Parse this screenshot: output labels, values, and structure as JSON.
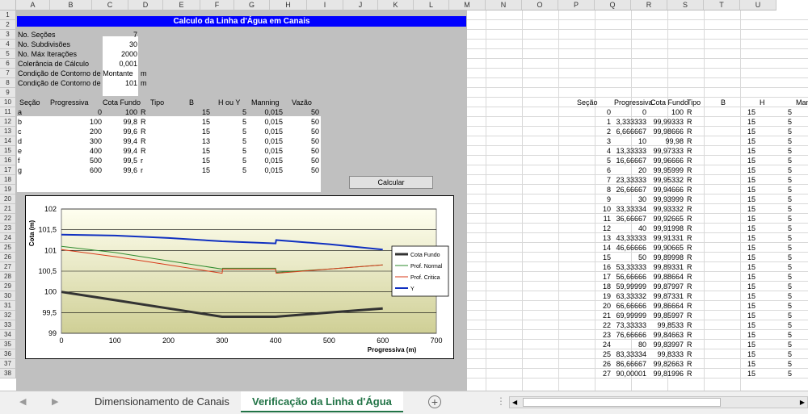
{
  "columns": [
    "A",
    "B",
    "C",
    "D",
    "E",
    "F",
    "G",
    "H",
    "I",
    "J",
    "K",
    "L",
    "M",
    "N",
    "O",
    "P",
    "Q",
    "R",
    "S",
    "T",
    "U"
  ],
  "rows": [
    "1",
    "2",
    "3",
    "4",
    "5",
    "6",
    "7",
    "8",
    "9",
    "10",
    "11",
    "12",
    "13",
    "14",
    "15",
    "16",
    "17",
    "18",
    "19",
    "20",
    "21",
    "22",
    "23",
    "24",
    "25",
    "26",
    "27",
    "28",
    "29",
    "30",
    "31",
    "32",
    "33",
    "34",
    "35",
    "36",
    "37",
    "38"
  ],
  "title": "Calculo da Linha d'Água em Canais",
  "params": [
    {
      "label": "No. Seções",
      "value": "7"
    },
    {
      "label": "No. Subdivisões",
      "value": "30"
    },
    {
      "label": "No. Máx Iterações",
      "value": "2000"
    },
    {
      "label": "Colerância de Cálculo",
      "value": "0,001"
    },
    {
      "label": "Condição de Contorno de Montante",
      "value": "",
      "unit": "m"
    },
    {
      "label": "Condição de Contorno de",
      "value": "101",
      "unit": "m"
    }
  ],
  "sections_header": [
    "Seção",
    "Progressiva",
    "Cota Fundo",
    "Tipo",
    "B",
    "H ou Y",
    "Manning",
    "Vazão"
  ],
  "sections": [
    [
      "a",
      "0",
      "100",
      "R",
      "15",
      "5",
      "0,015",
      "50"
    ],
    [
      "b",
      "100",
      "99,8",
      "R",
      "15",
      "5",
      "0,015",
      "50"
    ],
    [
      "c",
      "200",
      "99,6",
      "R",
      "15",
      "5",
      "0,015",
      "50"
    ],
    [
      "d",
      "300",
      "99,4",
      "R",
      "13",
      "5",
      "0,015",
      "50"
    ],
    [
      "e",
      "400",
      "99,4",
      "R",
      "15",
      "5",
      "0,015",
      "50"
    ],
    [
      "f",
      "500",
      "99,5",
      "r",
      "15",
      "5",
      "0,015",
      "50"
    ],
    [
      "g",
      "600",
      "99,6",
      "r",
      "15",
      "5",
      "0,015",
      "50"
    ]
  ],
  "calc_button": "Calcular",
  "results_header": [
    "Seção",
    "Progressiva",
    "Cota Fundo",
    "Tipo",
    "B",
    "H",
    "Man"
  ],
  "results": [
    [
      "0",
      "0",
      "100",
      "R",
      "15",
      "5"
    ],
    [
      "1",
      "3,333333",
      "99,99333",
      "R",
      "15",
      "5"
    ],
    [
      "2",
      "6,666667",
      "99,98666",
      "R",
      "15",
      "5"
    ],
    [
      "3",
      "10",
      "99,98",
      "R",
      "15",
      "5"
    ],
    [
      "4",
      "13,33333",
      "99,97333",
      "R",
      "15",
      "5"
    ],
    [
      "5",
      "16,66667",
      "99,96666",
      "R",
      "15",
      "5"
    ],
    [
      "6",
      "20",
      "99,95999",
      "R",
      "15",
      "5"
    ],
    [
      "7",
      "23,33333",
      "99,95332",
      "R",
      "15",
      "5"
    ],
    [
      "8",
      "26,66667",
      "99,94666",
      "R",
      "15",
      "5"
    ],
    [
      "9",
      "30",
      "99,93999",
      "R",
      "15",
      "5"
    ],
    [
      "10",
      "33,33334",
      "99,93332",
      "R",
      "15",
      "5"
    ],
    [
      "11",
      "36,66667",
      "99,92665",
      "R",
      "15",
      "5"
    ],
    [
      "12",
      "40",
      "99,91998",
      "R",
      "15",
      "5"
    ],
    [
      "13",
      "43,33333",
      "99,91331",
      "R",
      "15",
      "5"
    ],
    [
      "14",
      "46,66666",
      "99,90665",
      "R",
      "15",
      "5"
    ],
    [
      "15",
      "50",
      "99,89998",
      "R",
      "15",
      "5"
    ],
    [
      "16",
      "53,33333",
      "99,89331",
      "R",
      "15",
      "5"
    ],
    [
      "17",
      "56,66666",
      "99,88664",
      "R",
      "15",
      "5"
    ],
    [
      "18",
      "59,99999",
      "99,87997",
      "R",
      "15",
      "5"
    ],
    [
      "19",
      "63,33332",
      "99,87331",
      "R",
      "15",
      "5"
    ],
    [
      "20",
      "66,66666",
      "99,86664",
      "R",
      "15",
      "5"
    ],
    [
      "21",
      "69,99999",
      "99,85997",
      "R",
      "15",
      "5"
    ],
    [
      "22",
      "73,33333",
      "99,8533",
      "R",
      "15",
      "5"
    ],
    [
      "23",
      "76,66666",
      "99,84663",
      "R",
      "15",
      "5"
    ],
    [
      "24",
      "80",
      "99,83997",
      "R",
      "15",
      "5"
    ],
    [
      "25",
      "83,33334",
      "99,8333",
      "R",
      "15",
      "5"
    ],
    [
      "26",
      "86,66667",
      "99,82663",
      "R",
      "15",
      "5"
    ],
    [
      "27",
      "90,00001",
      "99,81996",
      "R",
      "15",
      "5"
    ]
  ],
  "tabs": [
    "Dimensionamento de Canais",
    "Verificação da Linha d'Água"
  ],
  "active_tab": 1,
  "chart_data": {
    "type": "line",
    "ylabel": "Cota (m)",
    "xlabel": "Progressiva (m)",
    "xlim": [
      0,
      700
    ],
    "ylim": [
      99,
      102
    ],
    "xticks": [
      "0",
      "100",
      "200",
      "300",
      "400",
      "500",
      "600",
      "700"
    ],
    "yticks": [
      "99",
      "99,5",
      "100",
      "100,5",
      "101",
      "101,5",
      "102"
    ],
    "legend": "right",
    "series": [
      {
        "name": "Cota Fundo",
        "color": "#333333",
        "x": [
          0,
          100,
          200,
          300,
          400,
          500,
          600
        ],
        "y": [
          100,
          99.8,
          99.6,
          99.4,
          99.4,
          99.5,
          99.6
        ]
      },
      {
        "name": "Prof. Normal",
        "color": "#2e8b2e",
        "x": [
          0,
          100,
          200,
          300,
          301,
          400,
          401,
          500,
          600
        ],
        "y": [
          101.1,
          100.95,
          100.75,
          100.55,
          100.57,
          100.57,
          100.47,
          100.55,
          100.65
        ]
      },
      {
        "name": "Prof. Critica",
        "color": "#d83a1a",
        "x": [
          0,
          100,
          200,
          300,
          301,
          400,
          401,
          500,
          600
        ],
        "y": [
          101.02,
          100.85,
          100.65,
          100.45,
          100.55,
          100.55,
          100.45,
          100.55,
          100.65
        ]
      },
      {
        "name": "Y",
        "color": "#1030c0",
        "x": [
          0,
          100,
          200,
          300,
          400,
          401,
          500,
          600
        ],
        "y": [
          101.38,
          101.36,
          101.3,
          101.22,
          101.17,
          101.25,
          101.15,
          101.02
        ]
      }
    ]
  }
}
